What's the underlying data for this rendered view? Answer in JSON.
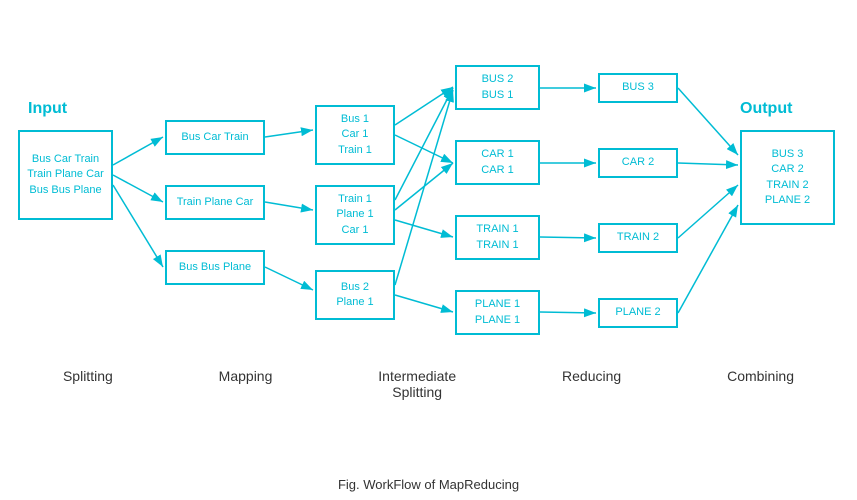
{
  "title": "Fig. WorkFlow of MapReducing",
  "sections": {
    "input_label": "Input",
    "output_label": "Output",
    "stage_labels": [
      "Splitting",
      "Mapping",
      "Intermediate\nSplitting",
      "Reducing",
      "Combining"
    ]
  },
  "boxes": {
    "input": "Bus Car Train\nTrain Plane Car\nBus Bus Plane",
    "map1": "Bus Car Train",
    "map2": "Train Plane Car",
    "map3": "Bus Bus Plane",
    "split1": "Bus 1\nCar 1\nTrain 1",
    "split2": "Train 1\nPlane 1\nCar 1",
    "split3": "Bus 2\nPlane 1",
    "inter1": "BUS 2\nBUS 1",
    "inter2": "CAR 1\nCAR 1",
    "inter3": "TRAIN 1\nTRAIN 1",
    "inter4": "PLANE 1\nPLANE 1",
    "reduce1": "BUS 3",
    "reduce2": "CAR 2",
    "reduce3": "TRAIN 2",
    "reduce4": "PLANE 2",
    "output": "BUS 3\nCAR 2\nTRAIN 2\nPLANE 2"
  }
}
